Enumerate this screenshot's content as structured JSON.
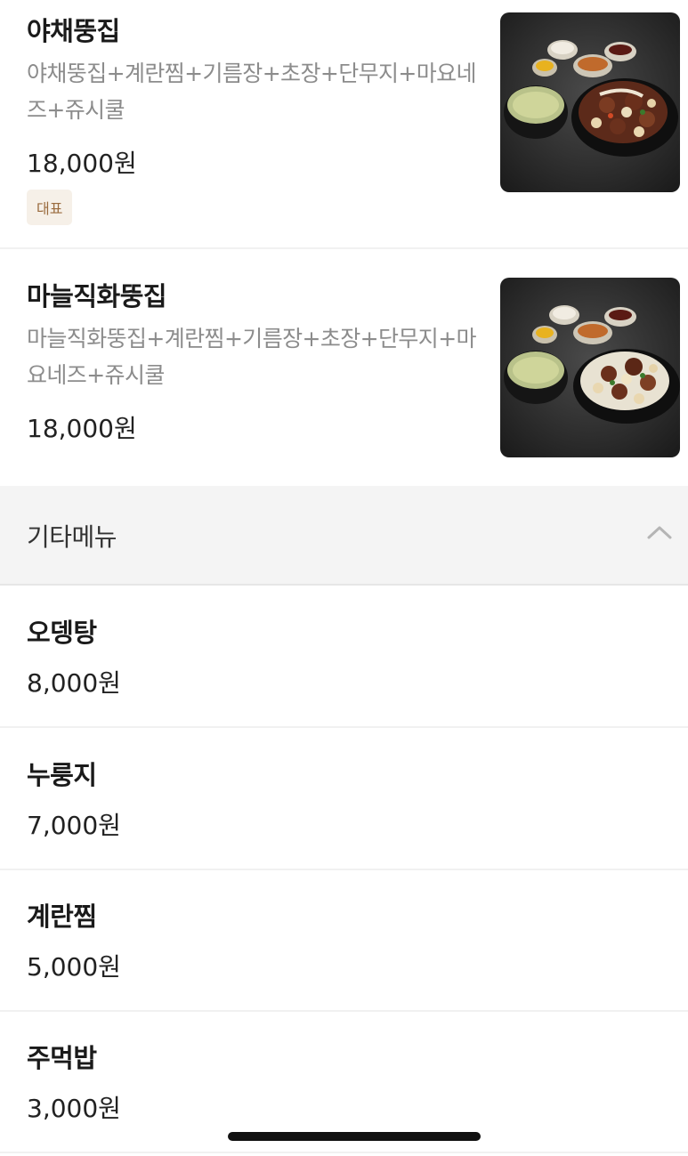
{
  "menu_items": [
    {
      "name": "야채뚱집",
      "description": "야채뚱집+계란찜+기름장+초장+단무지+마요네즈+쥬시쿨",
      "price": "18,000원",
      "badge": "대표",
      "image": "food-photo-beef-tripe-set"
    },
    {
      "name": "마늘직화뚱집",
      "description": "마늘직화뚱집+계란찜+기름장+초장+단무지+마요네즈+쥬시쿨",
      "price": "18,000원",
      "image": "food-photo-garlic-tripe-set"
    }
  ],
  "category": {
    "label": "기타메뉴",
    "icon": "chevron-up-icon"
  },
  "other_items": [
    {
      "name": "오뎅탕",
      "price": "8,000원"
    },
    {
      "name": "누룽지",
      "price": "7,000원"
    },
    {
      "name": "계란찜",
      "price": "5,000원"
    },
    {
      "name": "주먹밥",
      "price": "3,000원"
    }
  ],
  "colors": {
    "badge_bg": "#f6f0e8",
    "badge_text": "#9a6b3e",
    "category_bg": "#f4f4f4",
    "description_text": "#8c8c8c"
  }
}
